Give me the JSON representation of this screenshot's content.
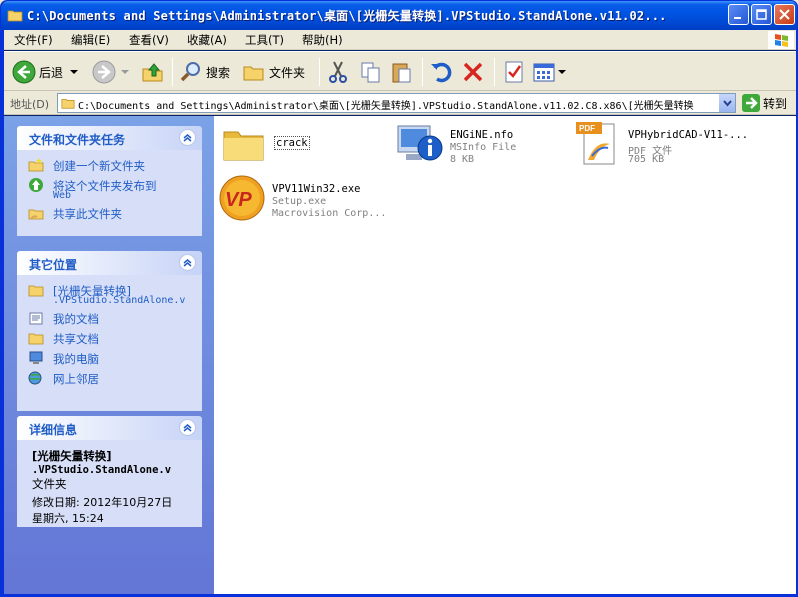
{
  "window": {
    "title": "C:\\Documents and Settings\\Administrator\\桌面\\[光栅矢量转换].VPStudio.StandAlone.v11.02..."
  },
  "menu": {
    "items": [
      "文件(F)",
      "编辑(E)",
      "查看(V)",
      "收藏(A)",
      "工具(T)",
      "帮助(H)"
    ]
  },
  "toolbar": {
    "back": "后退",
    "search": "搜索",
    "folders": "文件夹"
  },
  "address": {
    "label": "地址(D)",
    "value": "C:\\Documents and Settings\\Administrator\\桌面\\[光栅矢量转换].VPStudio.StandAlone.v11.02.C8.x86\\[光栅矢量转换",
    "go": "转到"
  },
  "left": {
    "tasks": {
      "title": "文件和文件夹任务",
      "items": [
        {
          "label": "创建一个新文件夹",
          "icon": "new-folder-icon"
        },
        {
          "label": "将这个文件夹发布到",
          "label2": "Web",
          "icon": "publish-web-icon"
        },
        {
          "label": "共享此文件夹",
          "icon": "share-folder-icon"
        }
      ]
    },
    "places": {
      "title": "其它位置",
      "items": [
        {
          "label": "[光栅矢量转换]",
          "label2": ".VPStudio.StandAlone.v",
          "icon": "folder-icon"
        },
        {
          "label": "我的文档",
          "icon": "my-documents-icon"
        },
        {
          "label": "共享文档",
          "icon": "shared-documents-icon"
        },
        {
          "label": "我的电脑",
          "icon": "my-computer-icon"
        },
        {
          "label": "网上邻居",
          "icon": "network-places-icon"
        }
      ]
    },
    "details": {
      "title": "详细信息",
      "name1": "[光栅矢量转换]",
      "name2": ".VPStudio.StandAlone.v",
      "type": "文件夹",
      "modified": "修改日期: 2012年10月27日",
      "modified2": "星期六, 15:24"
    }
  },
  "files": [
    {
      "name": "crack",
      "icon": "folder-icon"
    },
    {
      "name": "ENGiNE.nfo",
      "sub1": "MSInfo File",
      "sub2": "8 KB",
      "icon": "msinfo-icon"
    },
    {
      "name": "VPHybridCAD-V11-...",
      "sub1": "PDF 文件",
      "sub2": "705 KB",
      "icon": "pdf-icon"
    },
    {
      "name": "VPV11Win32.exe",
      "sub1": "Setup.exe",
      "sub2": "Macrovision Corp...",
      "icon": "vp-setup-icon"
    }
  ],
  "colors": {
    "titlebar": "#0054E3",
    "panel": "#6375D6",
    "link": "#215DC6"
  }
}
